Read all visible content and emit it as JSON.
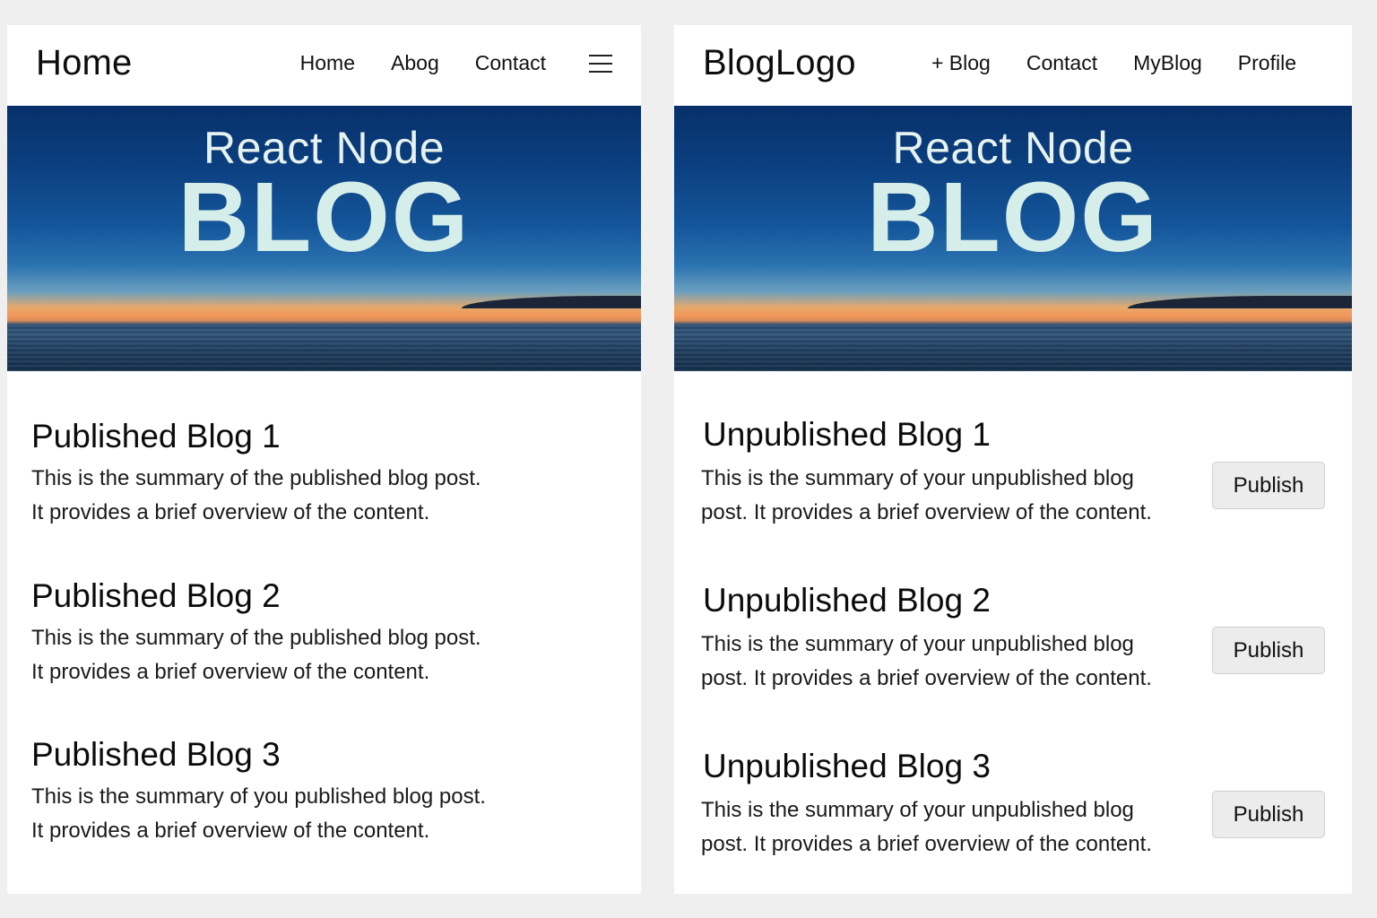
{
  "left": {
    "header": {
      "brand": "Home",
      "nav": [
        "Home",
        "Abog",
        "Contact"
      ],
      "menu_icon": "hamburger-menu-icon"
    },
    "hero": {
      "subtitle": "React Node",
      "title": "BLOG"
    },
    "posts": [
      {
        "title": "Published Blog 1",
        "summary_line1": "This is the summary of the  published blog post.",
        "summary_line2": "It provides a brief overview of the content."
      },
      {
        "title": "Published Blog 2",
        "summary_line1": "This is the summary of the  published blog post.",
        "summary_line2": "It provides a brief overview of the content."
      },
      {
        "title": "Published Blog 3",
        "summary_line1": "This is the summary of you published blog post.",
        "summary_line2": "It provides a brief overview of the content."
      }
    ]
  },
  "right": {
    "header": {
      "brand": "BlogLogo",
      "nav": [
        "+ Blog",
        "Contact",
        "MyBlog",
        "Profile"
      ]
    },
    "hero": {
      "subtitle": "React Node",
      "title": "BLOG"
    },
    "posts": [
      {
        "title": "Unpublished Blog 1",
        "summary_line1": "This is the summary of your unpublished blog",
        "summary_line2": "post. It provides a brief overview of the content.",
        "button": "Publish"
      },
      {
        "title": "Unpublished Blog 2",
        "summary_line1": "This is the summary of your unpublished blog",
        "summary_line2": "post. It provides a brief overview of the content.",
        "button": "Publish"
      },
      {
        "title": "Unpublished Blog 3",
        "summary_line1": "This is the summary of your unpublished blog",
        "summary_line2": "post. It provides a brief overview of the content.",
        "button": "Publish"
      }
    ]
  }
}
